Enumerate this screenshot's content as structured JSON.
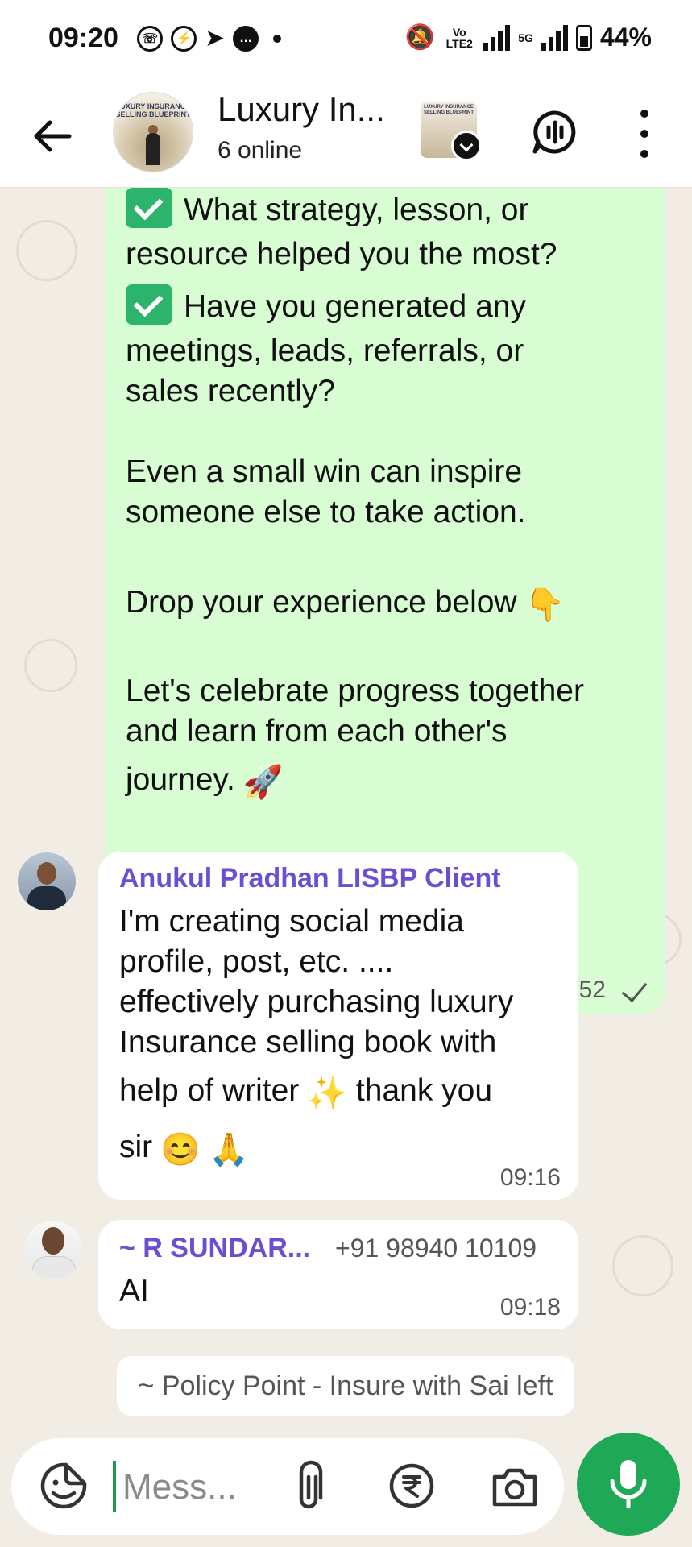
{
  "status_bar": {
    "time": "09:20",
    "battery": "44%",
    "volte_label": "Vo LTE2",
    "network_label": "5G"
  },
  "header": {
    "title": "Luxury In...",
    "subtitle": "6 online",
    "avatar_caption": "LUXURY INSURANCE SELLING BLUEPRINT"
  },
  "messages": {
    "outgoing": {
      "lines": [
        "What strategy, lesson, or",
        "resource helped you the most?",
        "Have you generated any",
        "meetings, leads, referrals, or",
        "sales recently?",
        "Even a small win can inspire",
        "someone else to take action.",
        "Drop your experience below",
        "Let's celebrate progress together",
        "and learn from each other's",
        "journey."
      ],
      "emoji_point": "👇",
      "emoji_rocket": "🚀",
      "time": "08:52"
    },
    "incoming_1": {
      "sender": "Anukul Pradhan LISBP Client",
      "lines": [
        "I'm creating social media",
        "profile, post, etc. ....",
        "effectively purchasing luxury",
        "Insurance selling book with",
        "help of writer",
        "thank you",
        "sir"
      ],
      "emoji_sparkles": "✨",
      "emoji_smile": "😊",
      "emoji_pray": "🙏",
      "time": "09:16"
    },
    "incoming_2": {
      "sender": "~ R SUNDAR...",
      "phone": "+91 98940 10109",
      "text": "AI",
      "time": "09:18"
    },
    "system_notice": "~ Policy Point - Insure with Sai left"
  },
  "composer": {
    "placeholder": "Mess..."
  },
  "colors": {
    "outgoing_bubble": "#d9fdd3",
    "sender_name": "#6b4fd0",
    "mic_button": "#1fa855",
    "chat_background": "#f1ece4"
  }
}
